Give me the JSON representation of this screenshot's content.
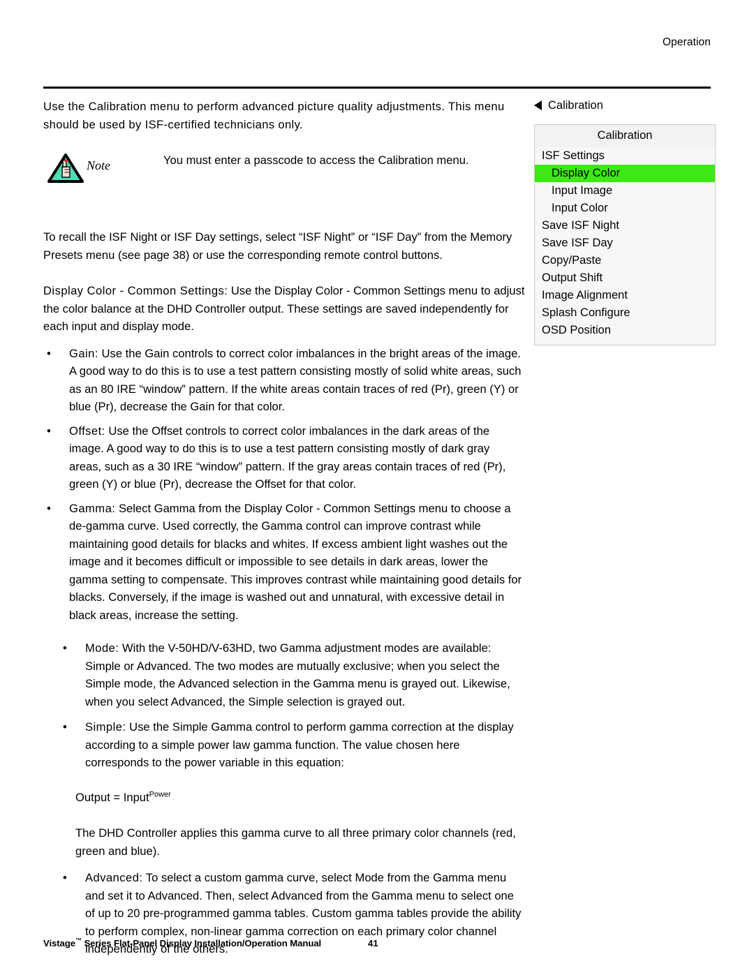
{
  "header": {
    "section_label": "Operation"
  },
  "intro": {
    "paragraph": "Use the Calibration menu to perform advanced picture quality adjustments. This menu should be used by ISF-certified technicians only."
  },
  "note": {
    "icon": "note-triangle-hand-icon",
    "label": "Note",
    "text": "You must enter a passcode to access the Calibration menu."
  },
  "recall": {
    "paragraph": "To recall the ISF Night or ISF Day settings, select “ISF Night” or “ISF Day” from the Memory Presets menu (see page 38) or use the corresponding remote control buttons."
  },
  "display_color": {
    "term": "Display Color - Common Settings:",
    "body": " Use the Display Color - Common Settings menu to adjust the color balance at the DHD Controller output. These settings are saved independently for each input and display mode."
  },
  "bullets": [
    {
      "marker": "•",
      "term": "Gain:",
      "body": " Use the Gain controls to correct color imbalances in the bright areas of the image. A good way to do this is to use a test pattern consisting mostly of solid white areas, such as an 80 IRE “window” pattern. If the white areas contain traces of red (Pr), green (Y) or blue (Pr), decrease the Gain for that color."
    },
    {
      "marker": "•",
      "term": "Offset:",
      "body": " Use the Offset controls to correct color imbalances in the dark areas of the image. A good way to do this is to use a test pattern consisting mostly of dark gray areas, such as a 30 IRE “window” pattern. If the gray areas contain traces of red (Pr), green (Y) or blue (Pr), decrease the Offset for that color."
    },
    {
      "marker": "•",
      "term": "Gamma:",
      "body": " Select Gamma from the Display Color - Common Settings menu to choose a de-gamma curve. Used correctly, the Gamma control can improve contrast while maintaining good details for blacks and whites. If excess ambient light washes out the image and it becomes difficult or impossible to see details in dark areas, lower the gamma setting to compensate. This improves contrast while maintaining good details for blacks. Conversely, if the image is washed out and unnatural, with excessive detail in black areas, increase the setting."
    }
  ],
  "sub_bullets": [
    {
      "marker": "•",
      "term": "Mode:",
      "body": " With the V-50HD/V-63HD, two Gamma adjustment modes are available: Simple or Advanced. The two modes are mutually exclusive; when you select the Simple mode, the Advanced selection in the Gamma menu is grayed out. Likewise, when you select Advanced, the Simple selection is grayed out."
    },
    {
      "marker": "•",
      "term": "Simple:",
      "body": " Use the Simple Gamma control to perform gamma correction at the display according to a simple power law gamma function. The value chosen here corresponds to the power variable in this equation:"
    }
  ],
  "equation": {
    "base": "Output = Input",
    "exponent": "Power"
  },
  "after_equation": {
    "paragraph": "The DHD Controller applies this gamma curve to all three primary color channels (red, green and blue)."
  },
  "advanced_bullet": {
    "marker": "•",
    "term": "Advanced:",
    "body": " To select a custom gamma curve, select Mode from the Gamma menu and set it to Advanced. Then, select Advanced from the Gamma menu to select one of up to 20 pre-programmed gamma tables. Custom gamma tables provide the ability to perform complex, non-linear gamma correction on each primary color channel independently of the others."
  },
  "osd": {
    "back_icon": "caret-left-icon",
    "caption": "Calibration",
    "panel_title": "Calibration",
    "selected_color": "#3ee814",
    "items": [
      {
        "label": "ISF Settings",
        "level": 1,
        "selected": false
      },
      {
        "label": "Display Color",
        "level": 2,
        "selected": true
      },
      {
        "label": "Input Image",
        "level": 2,
        "selected": false
      },
      {
        "label": "Input Color",
        "level": 2,
        "selected": false
      },
      {
        "label": "Save ISF Night",
        "level": 1,
        "selected": false
      },
      {
        "label": "Save ISF Day",
        "level": 1,
        "selected": false
      },
      {
        "label": "Copy/Paste",
        "level": 1,
        "selected": false
      },
      {
        "label": "Output Shift",
        "level": 1,
        "selected": false
      },
      {
        "label": "Image Alignment",
        "level": 1,
        "selected": false
      },
      {
        "label": "Splash Configure",
        "level": 1,
        "selected": false
      },
      {
        "label": "OSD Position",
        "level": 1,
        "selected": false
      }
    ]
  },
  "footer": {
    "manual_title_pre": "Vistage",
    "manual_title_tm": "™",
    "manual_title_post": " Series Flat-Panel Display Installation/Operation Manual",
    "page_number": "41"
  }
}
